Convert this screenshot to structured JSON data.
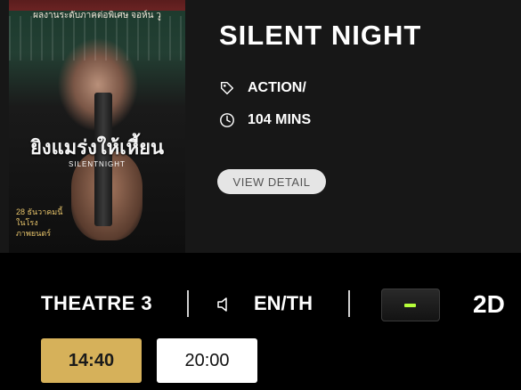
{
  "movie": {
    "title": "SILENT NIGHT",
    "genre": "ACTION/",
    "duration": "104 MINS",
    "detail_button": "VIEW DETAIL",
    "genre_icon": "tag-icon",
    "duration_icon": "clock-icon"
  },
  "poster": {
    "top_text": "ผลงานระดับภาคต่อพิเศษ จอห์น วู",
    "thai_title": "ยิงแมร่งให้เหี้ยน",
    "english_title": "SILENTNIGHT",
    "release_text": "28 ธันวาคมนี้ ในโรงภาพยนตร์"
  },
  "showing": {
    "theatre": "THEATRE 3",
    "audio_icon": "speaker-icon",
    "language": "EN/TH",
    "format": "2D",
    "accent": "#b6ff3a"
  },
  "showtimes": [
    {
      "time": "14:40",
      "selected": true
    },
    {
      "time": "20:00",
      "selected": false
    }
  ],
  "colors": {
    "selected_slot": "#d6b15a",
    "panel": "#171717"
  }
}
